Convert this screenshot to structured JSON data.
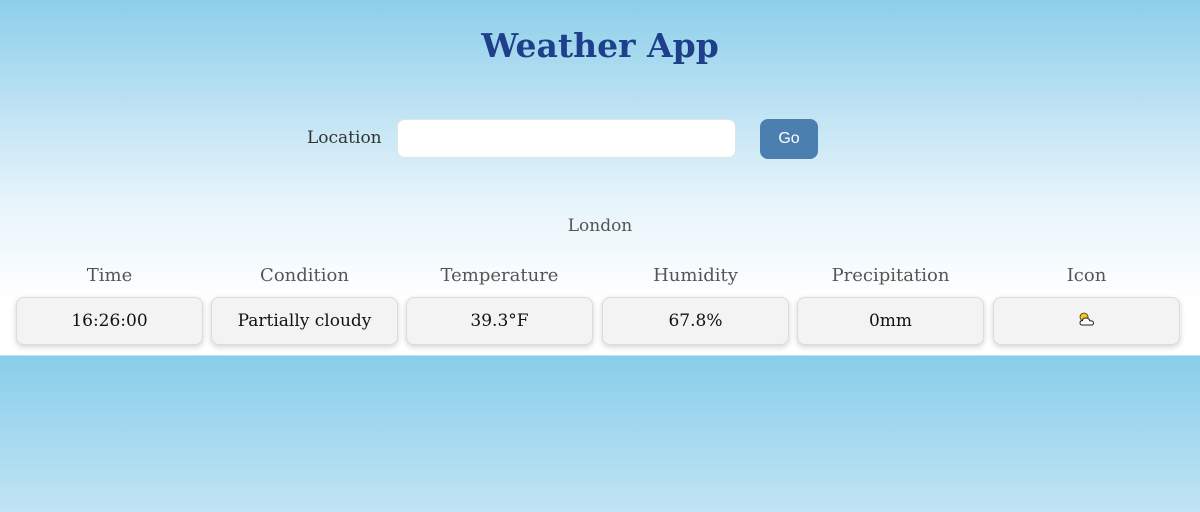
{
  "app": {
    "title": "Weather App"
  },
  "search": {
    "label": "Location",
    "value": "",
    "placeholder": "",
    "button_label": "Go"
  },
  "result": {
    "city": "London",
    "columns": [
      {
        "header": "Time",
        "value": "16:26:00"
      },
      {
        "header": "Condition",
        "value": "Partially cloudy"
      },
      {
        "header": "Temperature",
        "value": "39.3°F"
      },
      {
        "header": "Humidity",
        "value": "67.8%"
      },
      {
        "header": "Precipitation",
        "value": "0mm"
      },
      {
        "header": "Icon",
        "value": "partly-cloudy-icon"
      }
    ]
  },
  "colors": {
    "title": "#1f3f8a",
    "button": "#4a7faf",
    "sky_top": "#8ccfea"
  }
}
